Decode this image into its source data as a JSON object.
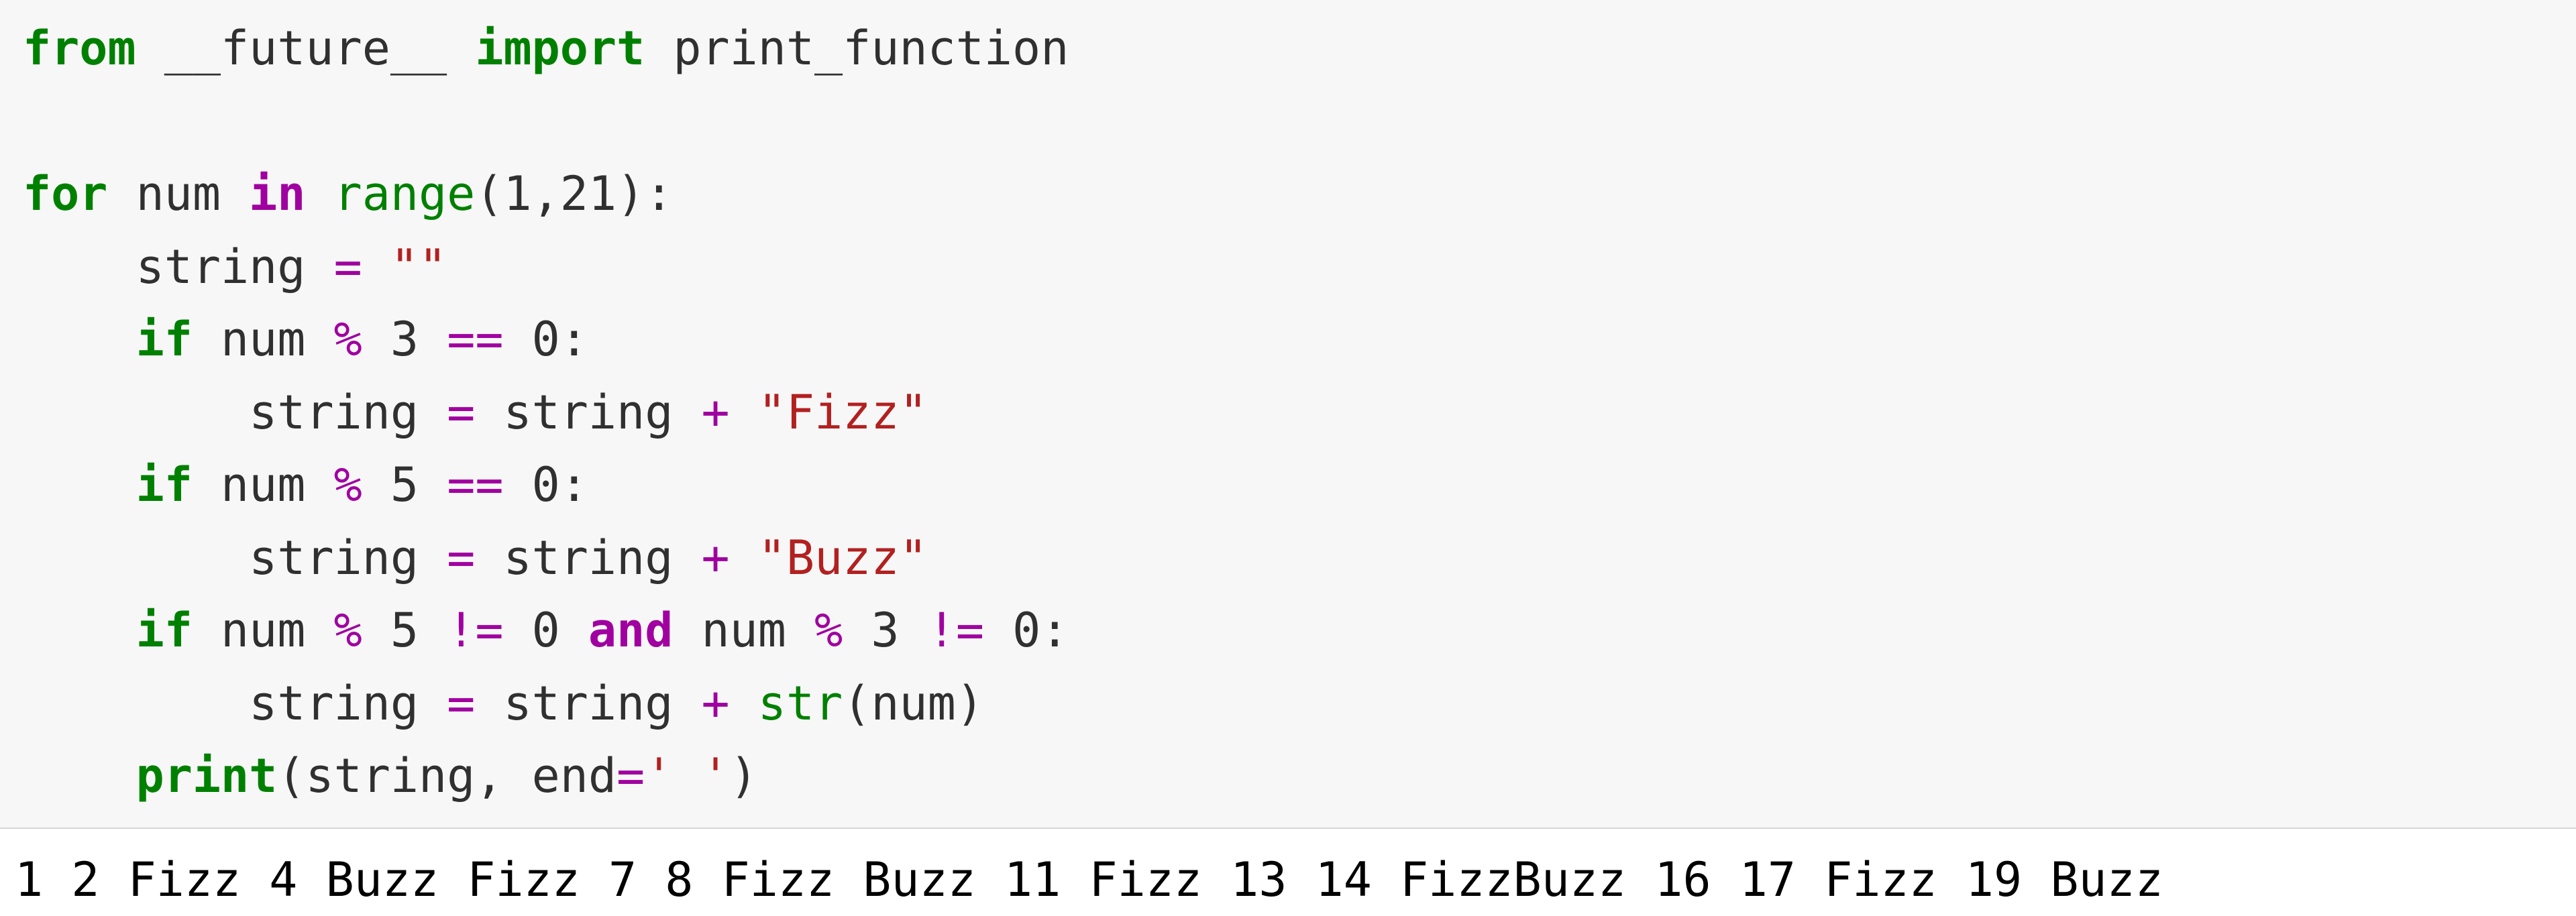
{
  "code": {
    "line1": {
      "from": "from",
      "future": " __future__ ",
      "import": "import",
      "printfn": " print_function"
    },
    "line3": {
      "for": "for",
      "num": " num ",
      "in": "in",
      "range": " range",
      "args": "(",
      "n1": "1",
      "comma": ",",
      "n2": "21",
      "close": "):"
    },
    "line4": {
      "indent": "    ",
      "lhs": "string ",
      "eq": "=",
      "rhs": " ",
      "q1": "\"\"",
      "end": ""
    },
    "line5": {
      "indent": "    ",
      "if": "if",
      "sp": " num ",
      "pct": "%",
      "three": " 3 ",
      "eqeq": "==",
      "zero": " 0",
      "colon": ":"
    },
    "line6": {
      "indent": "        ",
      "lhs": "string ",
      "eq": "=",
      "rhs": " string ",
      "plus": "+",
      "sp": " ",
      "str": "\"Fizz\""
    },
    "line7": {
      "indent": "    ",
      "if": "if",
      "sp": " num ",
      "pct": "%",
      "five": " 5 ",
      "eqeq": "==",
      "zero": " 0",
      "colon": ":"
    },
    "line8": {
      "indent": "        ",
      "lhs": "string ",
      "eq": "=",
      "rhs": " string ",
      "plus": "+",
      "sp": " ",
      "str": "\"Buzz\""
    },
    "line9": {
      "indent": "    ",
      "if": "if",
      "sp1": " num ",
      "pct1": "%",
      "five": " 5 ",
      "ne1": "!=",
      "zero1": " 0 ",
      "and": "and",
      "sp2": " num ",
      "pct2": "%",
      "three": " 3 ",
      "ne2": "!=",
      "zero2": " 0",
      "colon": ":"
    },
    "line10": {
      "indent": "        ",
      "lhs": "string ",
      "eq": "=",
      "rhs": " string ",
      "plus": "+",
      "sp": " ",
      "strfn": "str",
      "args": "(num)"
    },
    "line11": {
      "indent": "    ",
      "print": "print",
      "open": "(string, end",
      "eq": "=",
      "q": "' '",
      "close": ")"
    }
  },
  "output": "1 2 Fizz 4 Buzz Fizz 7 8 Fizz Buzz 11 Fizz 13 14 FizzBuzz 16 17 Fizz 19 Buzz"
}
